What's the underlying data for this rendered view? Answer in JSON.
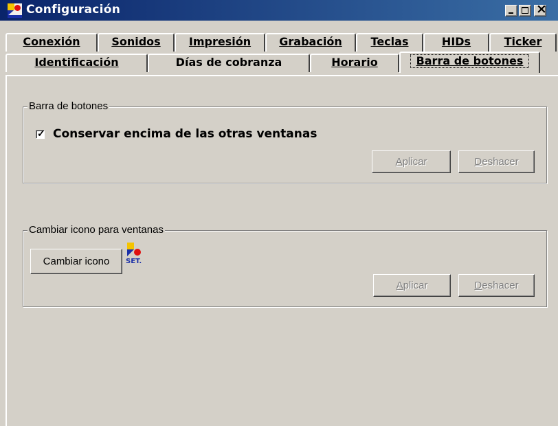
{
  "window": {
    "title": "Configuración"
  },
  "tabs": {
    "row1": [
      "Conexión",
      "Sonidos",
      "Impresión",
      "Grabación",
      "Teclas",
      "HIDs",
      "Ticker"
    ],
    "row2": [
      "Identificación",
      "Días de cobranza",
      "Horario",
      "Barra de botones"
    ],
    "active": "Barra de botones"
  },
  "group_toolbar": {
    "legend": "Barra de botones",
    "checkbox_label": "Conservar encima de las otras ventanas",
    "checked": true,
    "apply_label": "Aplicar",
    "undo_label": "Deshacer"
  },
  "group_icon": {
    "legend": "Cambiar icono para ventanas",
    "change_icon_label": "Cambiar icono",
    "logo_text": "SET.",
    "apply_label": "Aplicar",
    "undo_label": "Deshacer"
  },
  "colors": {
    "titlebar_start": "#0a246a",
    "titlebar_end": "#3a6ea5",
    "face": "#d4d0c8",
    "disabled_text": "#808080"
  }
}
